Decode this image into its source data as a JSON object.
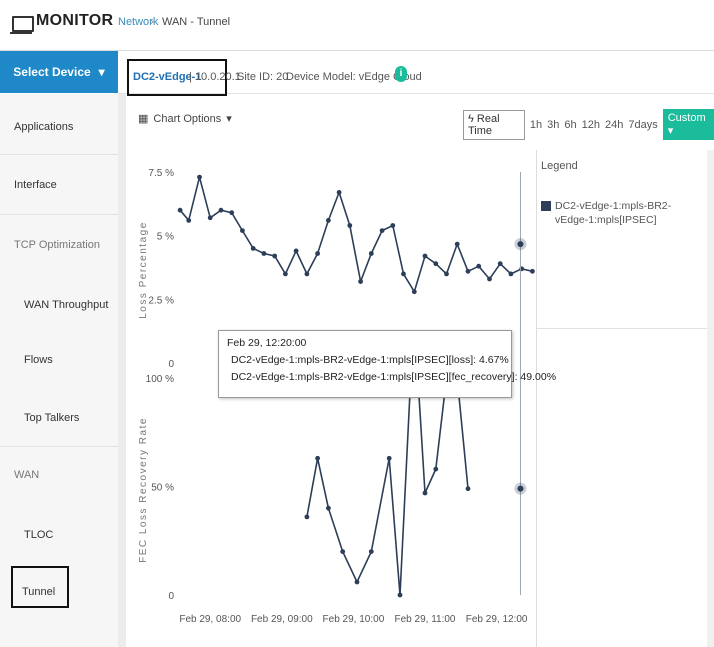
{
  "header": {
    "title": "MONITOR",
    "breadcrumb_link": "Network",
    "breadcrumb_sep": "›",
    "breadcrumb_current": "WAN - Tunnel"
  },
  "device_bar": {
    "select_label": "Select Device",
    "device_name": "DC2-vEdge-1",
    "device_ip": "| 10.0.20.1",
    "site_id": "Site ID: 20",
    "device_model": "Device Model: vEdge Cloud",
    "info_glyph": "i"
  },
  "sidebar": {
    "items": [
      {
        "label": "Applications"
      },
      {
        "label": "Interface"
      },
      {
        "label": "TCP Optimization"
      },
      {
        "label": "WAN Throughput"
      },
      {
        "label": "Flows"
      },
      {
        "label": "Top Talkers"
      },
      {
        "label": "WAN"
      },
      {
        "label": "TLOC"
      },
      {
        "label": "Tunnel"
      }
    ]
  },
  "toolbar": {
    "chart_options": "Chart Options",
    "real_time": "Real Time",
    "ranges": [
      "1h",
      "3h",
      "6h",
      "12h",
      "24h",
      "7days"
    ],
    "custom": "Custom"
  },
  "legend": {
    "title": "Legend",
    "item": "DC2-vEdge-1:mpls-BR2-vEdge-1:mpls[IPSEC]",
    "swatch_color": "#2d3e58"
  },
  "tooltip": {
    "time": "Feb 29, 12:20:00",
    "row1": "DC2-vEdge-1:mpls-BR2-vEdge-1:mpls[IPSEC][loss]: 4.67%",
    "row2": "DC2-vEdge-1:mpls-BR2-vEdge-1:mpls[IPSEC][fec_recovery]: 49.00%"
  },
  "chart_data": [
    {
      "type": "line",
      "ylabel": "Loss Percentage",
      "yticks": [
        "7.5 %",
        "5 %",
        "2.5 %",
        "0"
      ],
      "ylim": [
        0,
        7.5
      ],
      "xlim": [
        7.55,
        12.55
      ],
      "series": [
        {
          "x": [
            7.58,
            7.7,
            7.85,
            8.0,
            8.15,
            8.3,
            8.45,
            8.6,
            8.75,
            8.9,
            9.05,
            9.2,
            9.35,
            9.5,
            9.65,
            9.8,
            9.95,
            10.1,
            10.25,
            10.4,
            10.55,
            10.7,
            10.85,
            11.0,
            11.15,
            11.3,
            11.45,
            11.6,
            11.75,
            11.9,
            12.05,
            12.2,
            12.35,
            12.5
          ],
          "values": [
            6.0,
            5.6,
            7.3,
            5.7,
            6.0,
            5.9,
            5.2,
            4.5,
            4.3,
            4.2,
            3.5,
            4.4,
            3.5,
            4.3,
            5.6,
            6.7,
            5.4,
            3.2,
            4.3,
            5.2,
            5.4,
            3.5,
            2.8,
            4.2,
            3.9,
            3.5,
            4.67,
            3.6,
            3.8,
            3.3,
            3.9,
            3.5,
            3.7,
            3.6
          ]
        }
      ]
    },
    {
      "type": "line",
      "ylabel": "FEC Loss Recovery Rate",
      "yticks": [
        "100 %",
        "50 %",
        "0"
      ],
      "ylim": [
        0,
        100
      ],
      "xlim": [
        7.55,
        12.55
      ],
      "xticks": [
        "Feb 29, 08:00",
        "Feb 29, 09:00",
        "Feb 29, 10:00",
        "Feb 29, 11:00",
        "Feb 29, 12:00"
      ],
      "series": [
        {
          "x": [
            9.35,
            9.5,
            9.65,
            9.85,
            10.05,
            10.25,
            10.5,
            10.65,
            10.8,
            10.9,
            11.0,
            11.15,
            11.3,
            11.45,
            11.6
          ],
          "values": [
            36,
            63,
            40,
            20,
            6,
            20,
            63,
            0,
            100,
            100,
            47,
            58,
            100,
            100,
            49
          ]
        }
      ]
    }
  ]
}
